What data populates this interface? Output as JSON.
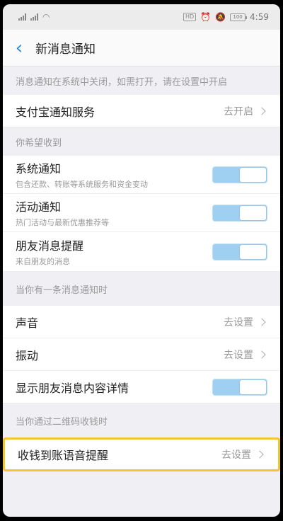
{
  "status_bar": {
    "hd_badge": "HD",
    "battery": "100",
    "time": "4:59"
  },
  "nav": {
    "title": "新消息通知"
  },
  "sections": {
    "notice": "消息通知在系统中关闭，如需打开，请在设置中开启",
    "receive": "你希望收到",
    "when_notify": "当你有一条消息通知时",
    "qr_receive": "当你通过二维码收钱时"
  },
  "rows": {
    "alipay_service": {
      "label": "支付宝通知服务",
      "action": "去开启"
    },
    "system_notice": {
      "label": "系统通知",
      "sub": "包含还款、转账等系统服务和资金变动",
      "enabled": true
    },
    "activity_notice": {
      "label": "活动通知",
      "sub": "热门活动与最新优惠推荐等",
      "enabled": true
    },
    "friend_message": {
      "label": "朋友消息提醒",
      "sub": "来自朋友的消息",
      "enabled": true
    },
    "sound": {
      "label": "声音",
      "action": "去设置"
    },
    "vibration": {
      "label": "振动",
      "action": "去设置"
    },
    "show_details": {
      "label": "显示朋友消息内容详情",
      "enabled": true
    },
    "voice_reminder": {
      "label": "收钱到账语音提醒",
      "action": "去设置"
    }
  },
  "colors": {
    "accent": "#2a8bd6",
    "toggle_on": "#9fd0f2",
    "highlight": "#f4c62e"
  }
}
